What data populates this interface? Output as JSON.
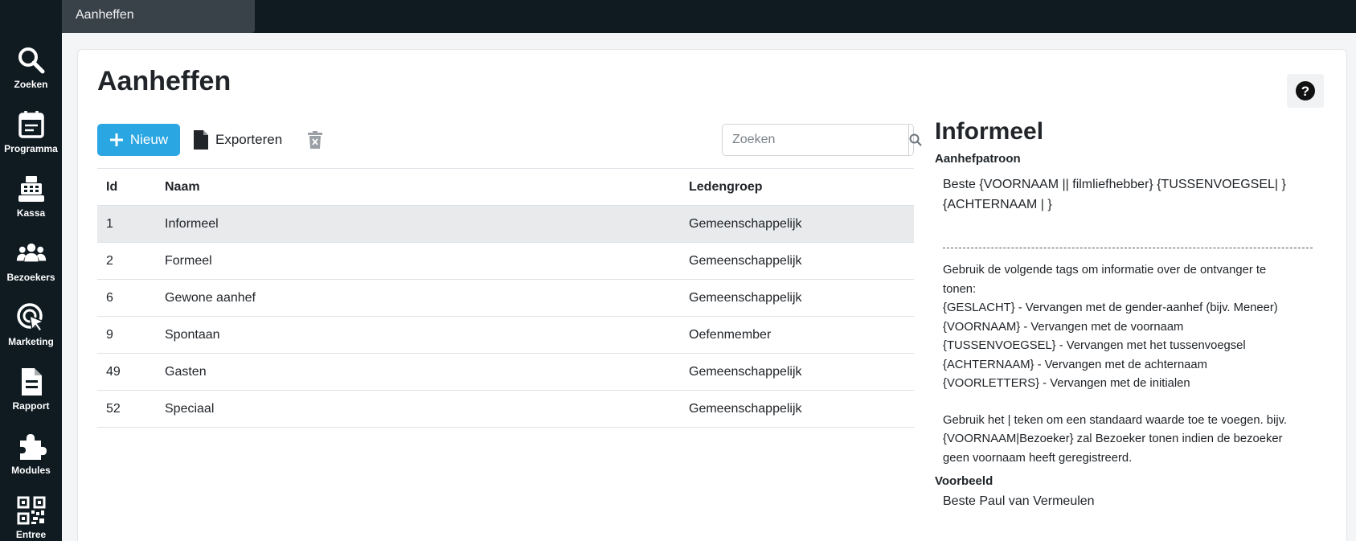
{
  "sidebar": {
    "items": [
      {
        "label": "Zoeken",
        "icon": "search-icon"
      },
      {
        "label": "Programma",
        "icon": "calendar-icon"
      },
      {
        "label": "Kassa",
        "icon": "cash-register-icon"
      },
      {
        "label": "Bezoekers",
        "icon": "users-icon"
      },
      {
        "label": "Marketing",
        "icon": "target-cursor-icon"
      },
      {
        "label": "Rapport",
        "icon": "report-icon"
      },
      {
        "label": "Modules",
        "icon": "puzzle-icon"
      },
      {
        "label": "Entree",
        "icon": "qr-code-icon"
      }
    ]
  },
  "tabs": [
    {
      "label": "Aanheffen"
    }
  ],
  "page": {
    "title": "Aanheffen"
  },
  "toolbar": {
    "new_label": "Nieuw",
    "export_label": "Exporteren",
    "search_placeholder": "Zoeken"
  },
  "table": {
    "columns": [
      "Id",
      "Naam",
      "Ledengroep"
    ],
    "rows": [
      {
        "id": "1",
        "naam": "Informeel",
        "ledengroep": "Gemeenschappelijk"
      },
      {
        "id": "2",
        "naam": "Formeel",
        "ledengroep": "Gemeenschappelijk"
      },
      {
        "id": "6",
        "naam": "Gewone aanhef",
        "ledengroep": "Gemeenschappelijk"
      },
      {
        "id": "9",
        "naam": "Spontaan",
        "ledengroep": "Oefenmember"
      },
      {
        "id": "49",
        "naam": "Gasten",
        "ledengroep": "Gemeenschappelijk"
      },
      {
        "id": "52",
        "naam": "Speciaal",
        "ledengroep": "Gemeenschappelijk"
      }
    ]
  },
  "detail": {
    "title": "Informeel",
    "pattern_label": "Aanhefpatroon",
    "pattern_line1": "Beste {VOORNAAM || filmliefhebber} {TUSSENVOEGSEL| }",
    "pattern_line2": "{ACHTERNAAM | }",
    "help": {
      "intro1": "Gebruik de volgende tags om informatie over de ontvanger te",
      "intro2": "tonen:",
      "tag1": "{GESLACHT} - Vervangen met de gender-aanhef (bijv. Meneer)",
      "tag2": "{VOORNAAM} - Vervangen met de voornaam",
      "tag3": "{TUSSENVOEGSEL} - Vervangen met het tussenvoegsel",
      "tag4": "{ACHTERNAAM} - Vervangen met de achternaam",
      "tag5": "{VOORLETTERS} - Vervangen met de initialen",
      "default1": "Gebruik het | teken om een standaard waarde toe te voegen. bijv.",
      "default2": "{VOORNAAM|Bezoeker} zal Bezoeker tonen indien de bezoeker",
      "default3": "geen voornaam heeft geregistreerd."
    },
    "example_label": "Voorbeeld",
    "example_value": "Beste Paul van Vermeulen"
  },
  "colors": {
    "sidebar_bg": "#0f1a21",
    "primary": "#2aa6e2",
    "active_row": "#e8eaec"
  }
}
